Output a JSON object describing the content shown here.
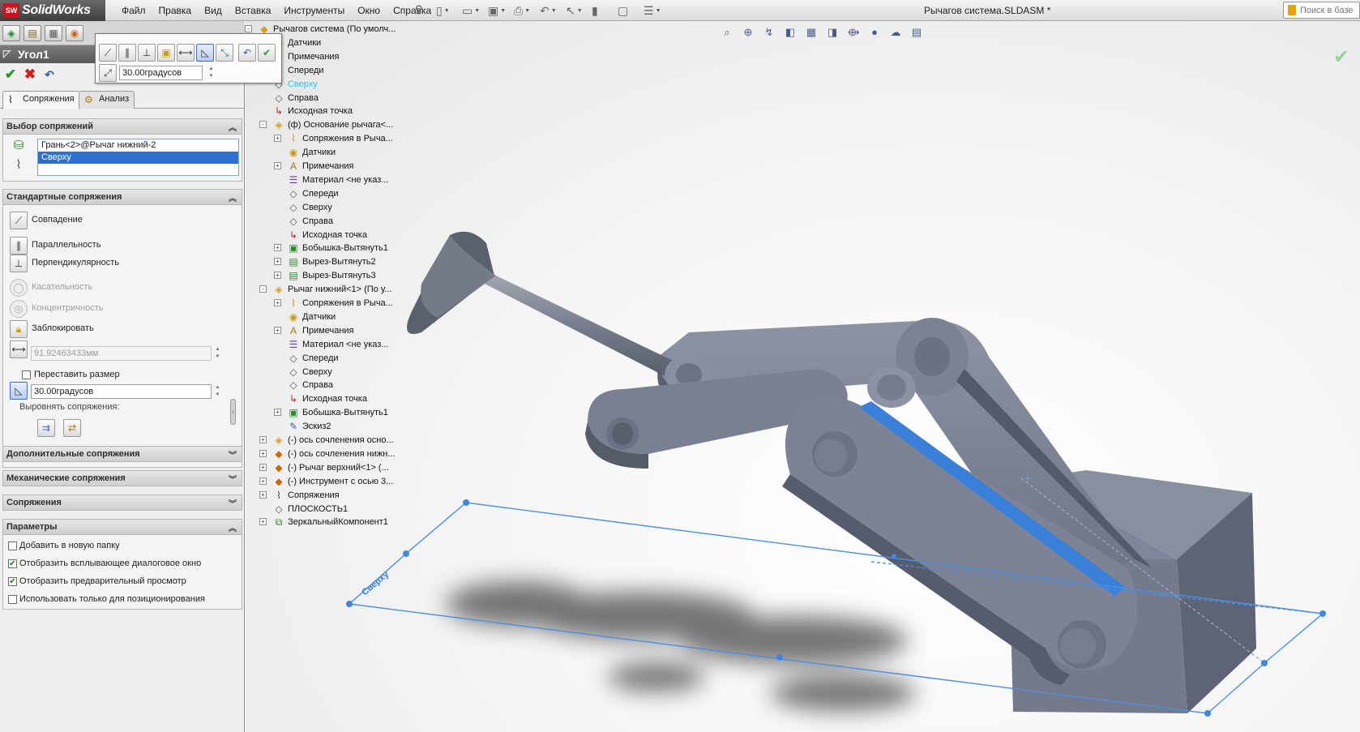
{
  "app": {
    "name": "SolidWorks",
    "logo_badge": "SW"
  },
  "menu": [
    "Файл",
    "Правка",
    "Вид",
    "Вставка",
    "Инструменты",
    "Окно",
    "Справка"
  ],
  "document_title": "Рычагов система.SLDASM *",
  "search": {
    "placeholder": "Поиск в базе"
  },
  "property_manager": {
    "title": "Угол1",
    "tabs": {
      "mates": "Сопряжения",
      "analysis": "Анализ"
    },
    "mate_selections": {
      "header": "Выбор сопряжений",
      "items": [
        "Грань<2>@Рычаг нижний-2",
        "Сверху"
      ]
    },
    "standard_mates": {
      "header": "Стандартные сопряжения",
      "coincident": "Совпадение",
      "parallel": "Параллельность",
      "perpendicular": "Перпендикулярность",
      "tangent": "Касательность",
      "concentric": "Концентричность",
      "lock": "Заблокировать",
      "distance_value": "91.92463433мм",
      "flip_dimension": "Переставить размер",
      "angle_value": "30.00градусов",
      "align_label": "Выровнять сопряжения:"
    },
    "advanced_header": "Дополнительные сопряжения",
    "mechanical_header": "Механические сопряжения",
    "mates_header": "Сопряжения",
    "options": {
      "header": "Параметры",
      "add_to_folder": "Добавить в новую папку",
      "show_popup": "Отобразить всплывающее диалоговое окно",
      "show_preview": "Отобразить предварительный просмотр",
      "positioning_only": "Использовать только для позиционирования",
      "add_to_folder_checked": false,
      "show_popup_checked": true,
      "show_preview_checked": true,
      "positioning_only_checked": false
    }
  },
  "popup_toolbar": {
    "angle_value": "30.00градусов"
  },
  "tree": [
    {
      "label": "Рычагов система  (По умолч...",
      "icon": "assembly-icon",
      "level": 0,
      "expand": "-"
    },
    {
      "label": "Датчики",
      "icon": "sensor-icon",
      "level": 1,
      "expand": ""
    },
    {
      "label": "Примечания",
      "icon": "annotation-icon",
      "level": 1,
      "expand": ""
    },
    {
      "label": "Спереди",
      "icon": "plane-icon",
      "level": 1,
      "expand": ""
    },
    {
      "label": "Сверху",
      "icon": "plane-icon",
      "level": 1,
      "expand": "",
      "highlight": true
    },
    {
      "label": "Справа",
      "icon": "plane-icon",
      "level": 1,
      "expand": ""
    },
    {
      "label": "Исходная точка",
      "icon": "origin-icon",
      "level": 1,
      "expand": ""
    },
    {
      "label": "(ф) Основание рычага<...",
      "icon": "part-icon",
      "level": 1,
      "expand": "-"
    },
    {
      "label": "Сопряжения в Рыча...",
      "icon": "mates-folder-icon",
      "level": 2,
      "expand": "+"
    },
    {
      "label": "Датчики",
      "icon": "sensor-icon",
      "level": 2,
      "expand": ""
    },
    {
      "label": "Примечания",
      "icon": "annotation-icon",
      "level": 2,
      "expand": "+"
    },
    {
      "label": "Материал <не указ...",
      "icon": "material-icon",
      "level": 2,
      "expand": ""
    },
    {
      "label": "Спереди",
      "icon": "plane-icon",
      "level": 2,
      "expand": ""
    },
    {
      "label": "Сверху",
      "icon": "plane-icon",
      "level": 2,
      "expand": ""
    },
    {
      "label": "Справа",
      "icon": "plane-icon",
      "level": 2,
      "expand": ""
    },
    {
      "label": "Исходная точка",
      "icon": "origin-icon",
      "level": 2,
      "expand": ""
    },
    {
      "label": "Бобышка-Вытянуть1",
      "icon": "extrude-icon",
      "level": 2,
      "expand": "+"
    },
    {
      "label": "Вырез-Вытянуть2",
      "icon": "cut-icon",
      "level": 2,
      "expand": "+"
    },
    {
      "label": "Вырез-Вытянуть3",
      "icon": "cut-icon",
      "level": 2,
      "expand": "+"
    },
    {
      "label": "Рычаг нижний<1> (По у...",
      "icon": "part-icon",
      "level": 1,
      "expand": "-"
    },
    {
      "label": "Сопряжения в Рыча...",
      "icon": "mates-folder-icon",
      "level": 2,
      "expand": "+"
    },
    {
      "label": "Датчики",
      "icon": "sensor-icon",
      "level": 2,
      "expand": ""
    },
    {
      "label": "Примечания",
      "icon": "annotation-icon",
      "level": 2,
      "expand": "+"
    },
    {
      "label": "Материал <не указ...",
      "icon": "material-icon",
      "level": 2,
      "expand": ""
    },
    {
      "label": "Спереди",
      "icon": "plane-icon",
      "level": 2,
      "expand": ""
    },
    {
      "label": "Сверху",
      "icon": "plane-icon",
      "level": 2,
      "expand": ""
    },
    {
      "label": "Справа",
      "icon": "plane-icon",
      "level": 2,
      "expand": ""
    },
    {
      "label": "Исходная точка",
      "icon": "origin-icon",
      "level": 2,
      "expand": ""
    },
    {
      "label": "Бобышка-Вытянуть1",
      "icon": "extrude-icon",
      "level": 2,
      "expand": "+"
    },
    {
      "label": "Эскиз2",
      "icon": "sketch-icon",
      "level": 2,
      "expand": ""
    },
    {
      "label": "(-) ось сочленения осно...",
      "icon": "part-icon",
      "level": 1,
      "expand": "+"
    },
    {
      "label": "(-) ось сочленения нижн...",
      "icon": "subassembly-icon",
      "level": 1,
      "expand": "+"
    },
    {
      "label": "(-) Рычаг верхний<1> (...",
      "icon": "subassembly-icon",
      "level": 1,
      "expand": "+"
    },
    {
      "label": "(-) Инструмент с осью 3...",
      "icon": "subassembly-icon",
      "level": 1,
      "expand": "+"
    },
    {
      "label": "Сопряжения",
      "icon": "mates-icon",
      "level": 1,
      "expand": "+"
    },
    {
      "label": "ПЛОСКОСТЬ1",
      "icon": "plane-icon",
      "level": 1,
      "expand": ""
    },
    {
      "label": "ЗеркальныйКомпонент1",
      "icon": "mirror-component-icon",
      "level": 1,
      "expand": "+"
    }
  ],
  "viewport": {
    "plane_label": "Сверху"
  },
  "colors": {
    "accent_blue": "#2f6fd0",
    "part_gray": "#6f7584",
    "plane_line": "#4a90e2",
    "highlight_face": "#3a7fd8"
  }
}
